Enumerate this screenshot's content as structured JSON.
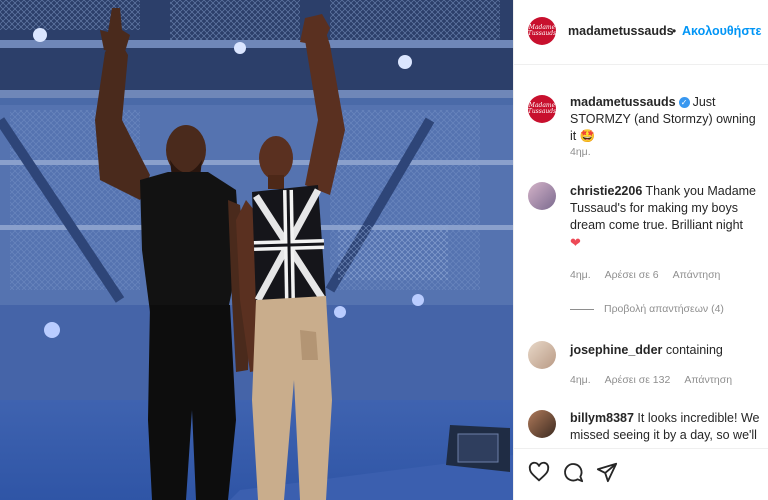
{
  "post": {
    "username": "madametussauds",
    "separator": "•",
    "follow_label": "Ακολουθήστε",
    "avatar_text": "Madame Tussauds"
  },
  "caption": {
    "username": "madametussauds",
    "verified_mark": "✓",
    "text": "Just STORMZY (and Stormzy) owning it 🤩",
    "time": "4ημ."
  },
  "comments": [
    {
      "username": "christie2206",
      "text": "Thank you Madame Tussaud's for making my boys dream come true. Brilliant night",
      "emoji": "❤",
      "time": "4ημ.",
      "likes": "Αρέσει σε 6",
      "reply": "Απάντηση",
      "view_replies": "Προβολή απαντήσεων (4)"
    },
    {
      "username": "josephine_dder",
      "text": "containing",
      "time": "4ημ.",
      "likes": "Αρέσει σε 132",
      "reply": "Απάντηση"
    },
    {
      "username": "billym8387",
      "text": "It looks incredible! We missed seeing it by a day, so we'll"
    }
  ],
  "actions": {
    "like_icon": "heart-outline-icon",
    "comment_icon": "comment-bubble-icon",
    "share_icon": "send-paper-plane-icon"
  },
  "colors": {
    "brand_red": "#c8102e",
    "link_blue": "#0095f6",
    "muted": "#8e8e8e",
    "stage_blue": "#4f6fae"
  }
}
